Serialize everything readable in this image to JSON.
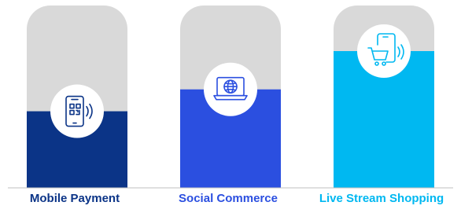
{
  "chart_data": {
    "type": "bar",
    "categories": [
      "Mobile Payment",
      "Social Commerce",
      "Live Stream Shopping"
    ],
    "values": [
      0.42,
      0.54,
      0.75
    ],
    "ylim": [
      0,
      1
    ],
    "grid": false,
    "bar_colors": [
      "#0B3487",
      "#2B4FE0",
      "#00B8F1"
    ],
    "background_bar_color": "#D9D9D9",
    "label_colors": [
      "#0B3487",
      "#2B4FE0",
      "#00B8F1"
    ],
    "baseline_color": "#BFBFBF",
    "icons": [
      "qr-code-phone-icon",
      "laptop-globe-icon",
      "phone-shopping-cart-icon"
    ]
  }
}
